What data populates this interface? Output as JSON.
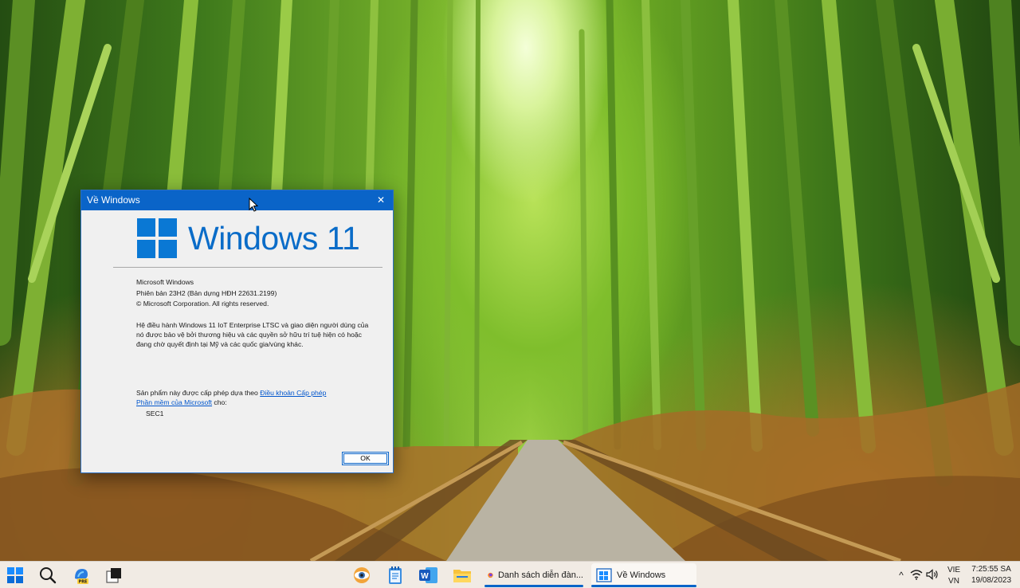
{
  "dialog": {
    "title": "Về Windows",
    "close_glyph": "✕",
    "brand": "Windows 11",
    "product_name": "Microsoft Windows",
    "version": "Phiên bản 23H2 (Bản dựng HĐH 22631.2199)",
    "copyright": "© Microsoft Corporation. All rights reserved.",
    "legal_text": "Hệ điều hành Windows 11 IoT Enterprise LTSC và giao diện người dùng của nó được bảo vệ bởi thương hiệu và các quyền sở hữu trí tuệ hiện có hoặc đang chờ quyết định tại Mỹ và các quốc gia/vùng khác.",
    "license_prefix": "Sản phẩm này được cấp phép dựa theo ",
    "license_link_1": "Điều khoản Cấp phép",
    "license_link_2": "Phần mềm của Microsoft",
    "license_suffix": " cho:",
    "licensee": "SEC1",
    "ok_label": "OK"
  },
  "taskbar": {
    "pinned": [
      {
        "name": "start-icon"
      },
      {
        "name": "search-icon"
      },
      {
        "name": "copilot-pre-icon"
      },
      {
        "name": "task-view-icon"
      }
    ],
    "apps": [
      {
        "name": "eye-app-icon"
      },
      {
        "name": "notepad-icon"
      },
      {
        "name": "word-icon"
      },
      {
        "name": "file-explorer-icon"
      }
    ],
    "tasks": [
      {
        "label": "Danh sách diễn đàn...",
        "icon": "firefox-icon"
      },
      {
        "label": "Về Windows",
        "icon": "windows-window-icon"
      }
    ],
    "tray": {
      "chevron": "^",
      "lang_line1": "VIE",
      "lang_line2": "VN",
      "time": "7:25:55 SA",
      "date": "19/08/2023"
    }
  },
  "colors": {
    "titlebar": "#0a64c8",
    "brand_blue": "#0a6cc8",
    "taskbar_bg": "#f1ebe4",
    "dialog_bg": "#f0f0f0"
  }
}
